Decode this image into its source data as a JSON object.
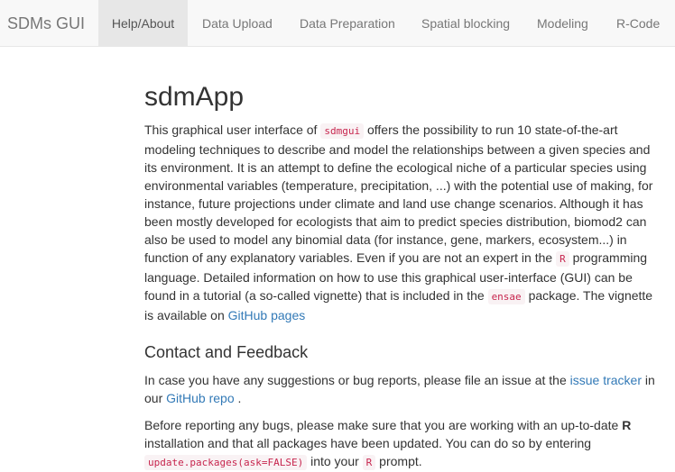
{
  "navbar": {
    "brand": "SDMs GUI",
    "tabs": [
      {
        "label": "Help/About",
        "active": true
      },
      {
        "label": "Data Upload",
        "active": false
      },
      {
        "label": "Data Preparation",
        "active": false
      },
      {
        "label": "Spatial blocking",
        "active": false
      },
      {
        "label": "Modeling",
        "active": false
      },
      {
        "label": "R-Code",
        "active": false
      }
    ]
  },
  "main": {
    "title": "sdmApp",
    "intro": {
      "t1": "This graphical user interface of ",
      "code1": "sdmgui",
      "t2": " offers the possibility to run 10 state-of-the-art modeling techniques to describe and model the relationships between a given species and its environment. It is an attempt to define the ecological niche of a particular species using environmental variables (temperature, precipitation, ...) with the potential use of making, for instance, future projections under climate and land use change scenarios. Although it has been mostly developed for ecologists that aim to predict species distribution, biomod2 can also be used to model any binomial data (for instance, gene, markers, ecosystem...) in function of any explanatory variables. Even if you are not an expert in the ",
      "code2": "R",
      "t3": " programming language. Detailed information on how to use this graphical user-interface (GUI) can be found in a tutorial (a so-called vignette) that is included in the ",
      "code3": "ensae",
      "t4": " package. The vignette is available on ",
      "link1": "GitHub pages"
    },
    "contact": {
      "heading": "Contact and Feedback",
      "t1": "In case you have any suggestions or bug reports, please file an issue at the ",
      "link1": "issue tracker",
      "t2": " in our ",
      "link2": "GitHub repo",
      "t3": " ."
    },
    "before": {
      "t1": "Before reporting any bugs, please make sure that you are working with an up-to-date ",
      "bold1": "R",
      "t2": " installation and that all packages have been updated. You can do so by entering ",
      "code1": "update.packages(ask=FALSE)",
      "t3": " into your ",
      "code2": "R",
      "t4": " prompt."
    }
  },
  "colors": {
    "navbar_bg": "#f8f8f8",
    "active_tab_bg": "#e7e7e7",
    "link": "#337ab7",
    "code_text": "#c7254e",
    "code_bg": "#f9f2f4"
  }
}
